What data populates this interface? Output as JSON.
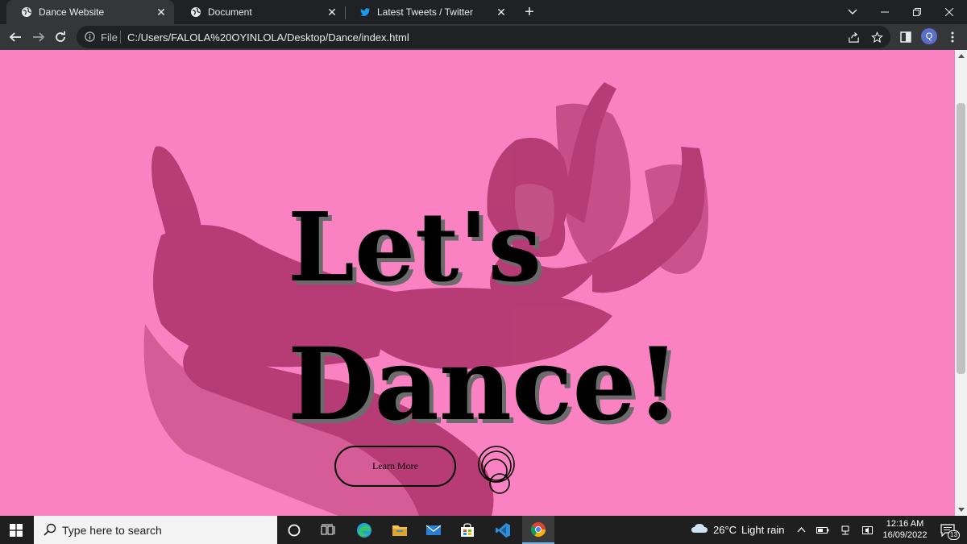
{
  "browser": {
    "tabs": [
      {
        "title": "Dance Website",
        "favicon": "globe-icon",
        "active": true
      },
      {
        "title": "Document",
        "favicon": "globe-icon",
        "active": false
      },
      {
        "title": "Latest Tweets / Twitter",
        "favicon": "twitter-bird-icon",
        "active": false
      }
    ],
    "new_tab_label": "+",
    "address": {
      "security_label": "File",
      "url": "C:/Users/FALOLA%20OYINLOLA/Desktop/Dance/index.html"
    },
    "profile_initial": "Q"
  },
  "page": {
    "hero_line_1": "Let's",
    "hero_line_2": "Dance!",
    "cta_label": "Learn More",
    "background_color": "#fa82c3"
  },
  "taskbar": {
    "search_placeholder": "Type here to search",
    "weather": {
      "temperature": "26°C",
      "condition": "Light rain"
    },
    "time": "12:16 AM",
    "date": "16/09/2022",
    "notification_count": "13"
  }
}
